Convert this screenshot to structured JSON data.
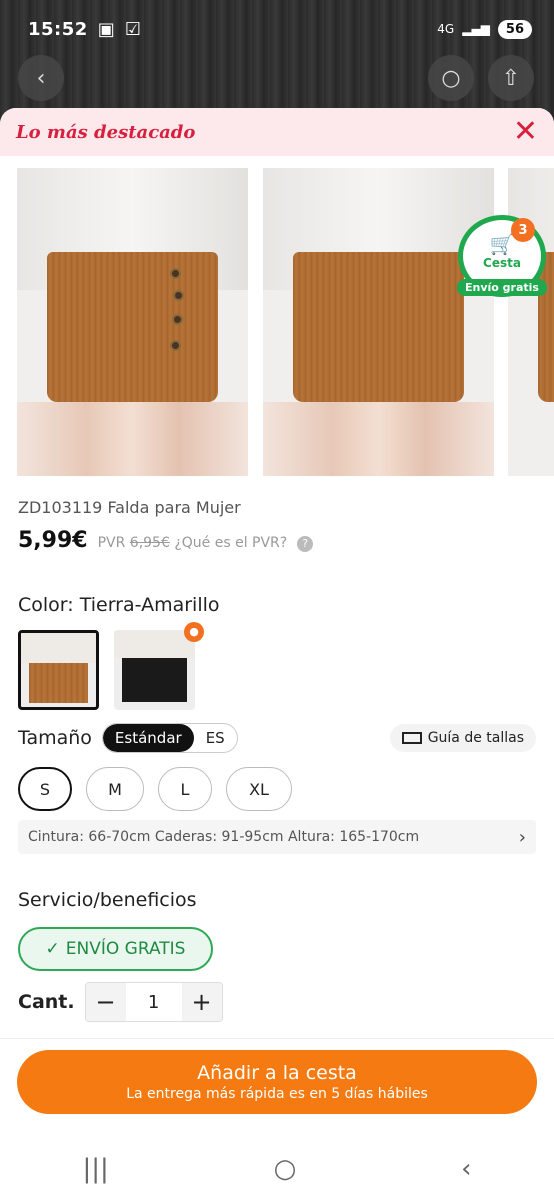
{
  "status": {
    "time": "15:52",
    "signal": "4G",
    "battery": "56"
  },
  "sheet": {
    "title": "Lo más destacado"
  },
  "cart": {
    "count": "3",
    "label": "Cesta",
    "badge": "Envío gratis"
  },
  "product": {
    "title": "ZD103119 Falda para Mujer",
    "price": "5,99€",
    "pvr_prefix": "PVR",
    "pvr_value": "6,95€",
    "pvr_question": "¿Qué es el PVR?"
  },
  "color": {
    "label": "Color: Tierra-Amarillo"
  },
  "size": {
    "label": "Tamaño",
    "toggle_on": "Estándar",
    "toggle_off": "ES",
    "guide": "Guía de tallas",
    "options": [
      "S",
      "M",
      "L",
      "XL"
    ],
    "measurements": "Cintura: 66-70cm Caderas: 91-95cm Altura: 165-170cm"
  },
  "service": {
    "label": "Servicio/beneficios",
    "free_shipping": "ENVÍO GRATIS"
  },
  "quantity": {
    "label": "Cant.",
    "value": "1"
  },
  "cta": {
    "label": "Añadir a la cesta",
    "sub": "La entrega más rápida es en 5 días hábiles"
  },
  "colors": {
    "accent": "#f47a11",
    "title_red": "#d6203e",
    "green": "#1fa84e"
  }
}
